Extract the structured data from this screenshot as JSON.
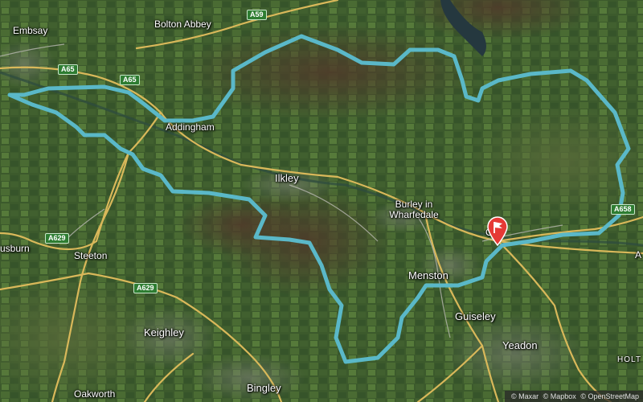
{
  "map": {
    "places": [
      {
        "id": "embsay",
        "label": "Embsay"
      },
      {
        "id": "bolton-abbey",
        "label": "Bolton Abbey"
      },
      {
        "id": "addingham",
        "label": "Addingham"
      },
      {
        "id": "ilkley",
        "label": "Ilkley"
      },
      {
        "id": "burley-l1",
        "label": "Burley in"
      },
      {
        "id": "burley-l2",
        "label": "Wharfedale"
      },
      {
        "id": "menston",
        "label": "Menston"
      },
      {
        "id": "guiseley",
        "label": "Guiseley"
      },
      {
        "id": "yeadon",
        "label": "Yeadon"
      },
      {
        "id": "steeton",
        "label": "Steeton"
      },
      {
        "id": "keighley",
        "label": "Keighley"
      },
      {
        "id": "bingley",
        "label": "Bingley"
      },
      {
        "id": "oakworth",
        "label": "Oakworth"
      },
      {
        "id": "cusburn",
        "label": "usburn"
      },
      {
        "id": "otley",
        "label": "O"
      },
      {
        "id": "holt",
        "label": "HOLT"
      },
      {
        "id": "edge-a",
        "label": "A"
      }
    ],
    "roads": [
      "A59",
      "A65",
      "A65",
      "A629",
      "A629",
      "A658"
    ],
    "route_color": "#5ab8c8",
    "marker": {
      "name": "flag-marker",
      "color": "#e53935"
    },
    "attribution": [
      "© Maxar",
      "© Mapbox",
      "© OpenStreetMap"
    ]
  }
}
